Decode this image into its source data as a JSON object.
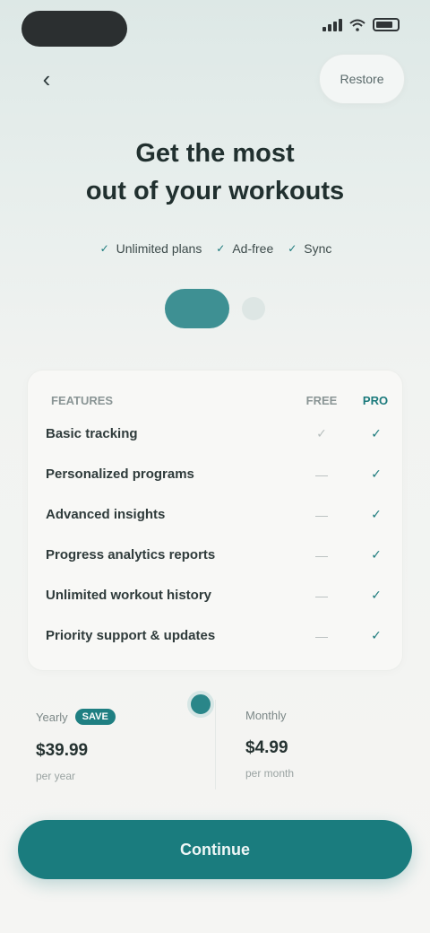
{
  "status_bar": {
    "time": ""
  },
  "top_bar": {
    "back_icon": "chevron-left-icon",
    "restore_label": "Restore"
  },
  "hero": {
    "title_line1": "Get the most",
    "title_line2": "out of your workouts",
    "benefits": [
      "Unlimited plans",
      "Ad-free",
      "Sync"
    ]
  },
  "carousel": {
    "pages": 2,
    "active_page": 1
  },
  "comparison": {
    "header_features": "FEATURES",
    "header_free": "FREE",
    "header_pro": "PRO",
    "rows": [
      {
        "label": "Basic tracking",
        "free": "✓",
        "pro": "✓"
      },
      {
        "label": "Personalized programs",
        "free": "—",
        "pro": "✓"
      },
      {
        "label": "Advanced insights",
        "free": "—",
        "pro": "✓"
      },
      {
        "label": "Progress analytics reports",
        "free": "—",
        "pro": "✓"
      },
      {
        "label": "Unlimited workout history",
        "free": "—",
        "pro": "✓"
      },
      {
        "label": "Priority support & updates",
        "free": "—",
        "pro": "✓"
      }
    ]
  },
  "plans": {
    "annual": {
      "caption": "Yearly",
      "badge": "SAVE",
      "price": "$39.99",
      "sub": "per year"
    },
    "monthly": {
      "caption": "Monthly",
      "price": "$4.99",
      "sub": "per month"
    }
  },
  "cta": {
    "label": "Continue"
  },
  "footer": {
    "note": ""
  },
  "colors": {
    "accent": "#1a7c7e",
    "text": "#21302f",
    "background": "#f5f5f3"
  }
}
